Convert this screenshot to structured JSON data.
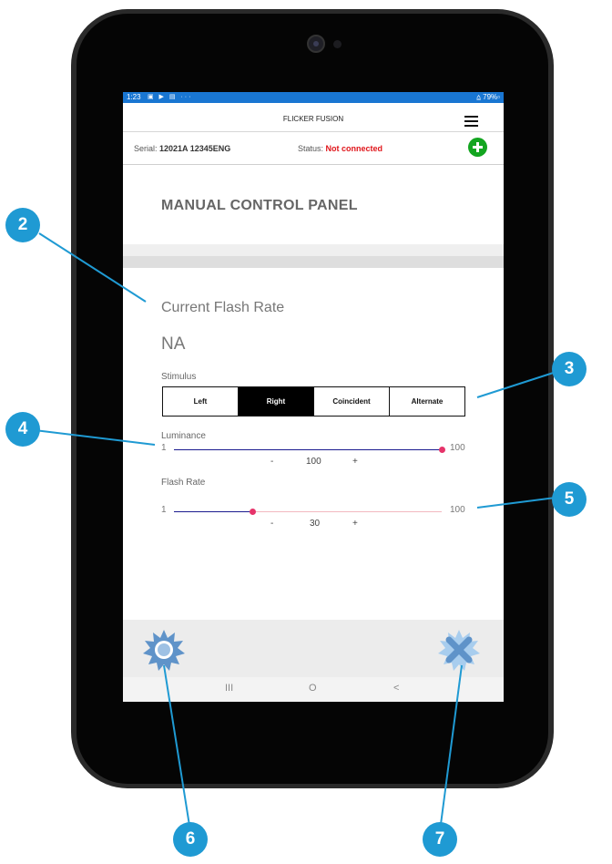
{
  "status_bar": {
    "time": "1:23",
    "icons": "▣ ▶ ▤ ···",
    "battery": "⩠ 79%▫"
  },
  "header": {
    "title": "FLICKER FUSION",
    "menu_icon": "hamburger-menu-icon"
  },
  "info": {
    "serial_label": "Serial:",
    "serial_value": "12021A 12345ENG",
    "status_label": "Status:",
    "status_value": "Not connected",
    "status_color": "#e0151a",
    "add_icon": "plus-circle-icon",
    "add_color": "#13a520"
  },
  "panel": {
    "title": "MANUAL CONTROL PANEL"
  },
  "flash": {
    "label": "Current Flash Rate",
    "value": "NA"
  },
  "stimulus": {
    "label": "Stimulus",
    "options": [
      "Left",
      "Right",
      "Coincident",
      "Alternate"
    ],
    "selected": "Right"
  },
  "luminance": {
    "label": "Luminance",
    "min": "1",
    "max": "100",
    "value": "100",
    "minus": "-",
    "plus": "+"
  },
  "flash_rate": {
    "label": "Flash Rate",
    "min": "1",
    "max": "100",
    "value": "30",
    "minus": "-",
    "plus": "+"
  },
  "bottom": {
    "left_icon": "starburst-start-icon",
    "right_icon": "starburst-stop-x-icon"
  },
  "nav": {
    "recents": "III",
    "home": "O",
    "back": "<"
  },
  "callouts": [
    "2",
    "3",
    "4",
    "5",
    "6",
    "7"
  ],
  "colors": {
    "status_bar": "#1976d2",
    "callout": "#1f9ad3",
    "slider_active": "#1a1a8f",
    "slider_thumb": "#e6336a"
  }
}
